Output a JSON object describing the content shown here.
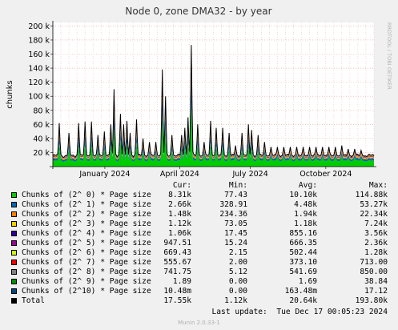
{
  "chart_data": {
    "type": "area",
    "title": "Node 0, zone DMA32 - by year",
    "ylabel": "chunks",
    "ylim": [
      0,
      205000
    ],
    "y_ticks": [
      20000,
      40000,
      60000,
      80000,
      100000,
      120000,
      140000,
      160000,
      180000,
      200000
    ],
    "y_tick_labels": [
      "20 k",
      "40 k",
      "60 k",
      "80 k",
      "100 k",
      "120 k",
      "140 k",
      "160 k",
      "180 k",
      "200 k"
    ],
    "x_ticks": [
      "January 2024",
      "April 2024",
      "July 2024",
      "October 2024"
    ],
    "grid": true,
    "side_label": "RRDTOOL / TOBI OETIKER",
    "spike_positions": [
      0.02,
      0.05,
      0.08,
      0.1,
      0.12,
      0.14,
      0.16,
      0.18,
      0.19,
      0.21,
      0.22,
      0.23,
      0.24,
      0.26,
      0.28,
      0.3,
      0.32,
      0.34,
      0.35,
      0.37,
      0.4,
      0.41,
      0.42,
      0.43,
      0.45,
      0.47,
      0.49,
      0.51,
      0.53,
      0.55,
      0.57,
      0.59,
      0.61,
      0.62,
      0.64,
      0.66,
      0.68,
      0.7,
      0.72,
      0.74,
      0.76,
      0.78,
      0.8,
      0.82,
      0.84,
      0.86,
      0.88,
      0.9,
      0.92,
      0.94,
      0.96
    ],
    "spike_values": [
      62000,
      48000,
      62000,
      64000,
      64000,
      45000,
      50000,
      60000,
      110000,
      75000,
      60000,
      65000,
      48000,
      67000,
      40000,
      35000,
      35000,
      138000,
      100000,
      45000,
      45000,
      55000,
      70000,
      173000,
      60000,
      35000,
      65000,
      55000,
      55000,
      48000,
      30000,
      48000,
      60000,
      52000,
      45000,
      35000,
      28000,
      28000,
      28000,
      28000,
      28000,
      28000,
      28000,
      28000,
      28000,
      28000,
      28000,
      30000,
      25000,
      25000,
      23000
    ],
    "series": [
      {
        "name": "Chunks of (2^ 0) * Page size",
        "color": "#00cc00",
        "cur": "8.31k",
        "min": "77.43",
        "avg": "10.10k",
        "max": "114.88k"
      },
      {
        "name": "Chunks of (2^ 1) * Page size",
        "color": "#0066b3",
        "cur": "2.66k",
        "min": "328.91",
        "avg": "4.48k",
        "max": "53.27k"
      },
      {
        "name": "Chunks of (2^ 2) * Page size",
        "color": "#ff8000",
        "cur": "1.48k",
        "min": "234.36",
        "avg": "1.94k",
        "max": "22.34k"
      },
      {
        "name": "Chunks of (2^ 3) * Page size",
        "color": "#ffcc00",
        "cur": "1.12k",
        "min": "73.05",
        "avg": "1.18k",
        "max": "7.24k"
      },
      {
        "name": "Chunks of (2^ 4) * Page size",
        "color": "#330099",
        "cur": "1.06k",
        "min": "17.45",
        "avg": "855.16",
        "max": "3.56k"
      },
      {
        "name": "Chunks of (2^ 5) * Page size",
        "color": "#990099",
        "cur": "947.51",
        "min": "15.24",
        "avg": "666.35",
        "max": "2.36k"
      },
      {
        "name": "Chunks of (2^ 6) * Page size",
        "color": "#ccff00",
        "cur": "669.43",
        "min": "2.15",
        "avg": "502.44",
        "max": "1.28k"
      },
      {
        "name": "Chunks of (2^ 7) * Page size",
        "color": "#ff0000",
        "cur": "555.67",
        "min": "2.00",
        "avg": "373.10",
        "max": "713.00"
      },
      {
        "name": "Chunks of (2^ 8) * Page size",
        "color": "#808080",
        "cur": "741.75",
        "min": "5.12",
        "avg": "541.69",
        "max": "850.00"
      },
      {
        "name": "Chunks of (2^ 9) * Page size",
        "color": "#008f00",
        "cur": "1.89",
        "min": "0.00",
        "avg": "1.69",
        "max": "38.84"
      },
      {
        "name": "Chunks of (2^10) * Page size",
        "color": "#00487d",
        "cur": "10.48m",
        "min": "0.00",
        "avg": "163.48m",
        "max": "17.12"
      },
      {
        "name": "Total",
        "color": "#000000",
        "cur": "17.55k",
        "min": "1.12k",
        "avg": "20.64k",
        "max": "193.80k"
      }
    ]
  },
  "legend_header": {
    "cur": "Cur:",
    "min": "Min:",
    "avg": "Avg:",
    "max": "Max:"
  },
  "footer": {
    "last_update": "Last update:  Tue Dec 17 00:05:23 2024",
    "munin": "Munin 2.0.33-1"
  }
}
